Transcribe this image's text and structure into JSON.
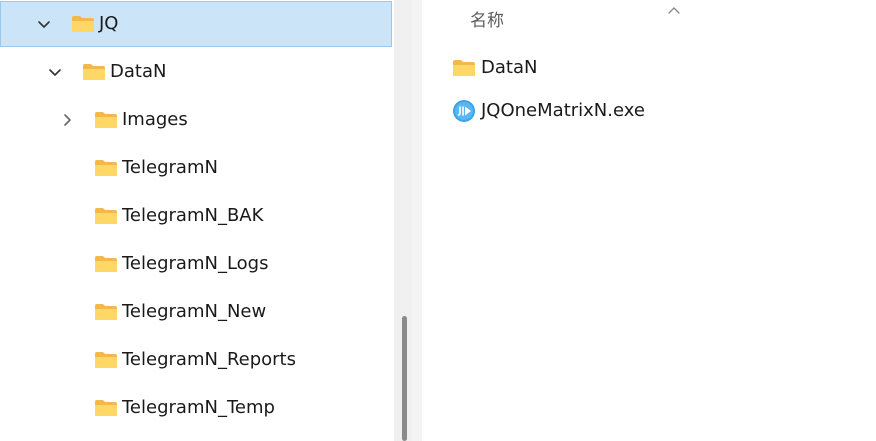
{
  "nav": {
    "items": [
      {
        "label": "JQ",
        "expanded": true,
        "level": 0,
        "selected": true
      },
      {
        "label": "DataN",
        "expanded": true,
        "level": 1
      },
      {
        "label": "Images",
        "expanded": false,
        "has_children": true,
        "level": 2
      },
      {
        "label": "TelegramN",
        "level": 2
      },
      {
        "label": "TelegramN_BAK",
        "level": 2
      },
      {
        "label": "TelegramN_Logs",
        "level": 2
      },
      {
        "label": "TelegramN_New",
        "level": 2
      },
      {
        "label": "TelegramN_Reports",
        "level": 2
      },
      {
        "label": "TelegramN_Temp",
        "level": 2
      }
    ]
  },
  "content": {
    "column_header": "名称",
    "sort_icon": "chevron-up-icon",
    "files": [
      {
        "name": "DataN",
        "type": "folder",
        "icon": "folder-icon"
      },
      {
        "name": "JQOneMatrixN.exe",
        "type": "application",
        "icon": "app-icon"
      }
    ]
  },
  "colors": {
    "selection_bg": "#cce4f7",
    "selection_border": "#99c9ef",
    "folder_yellow": "#ffd766",
    "folder_dark": "#f2b84b",
    "app_icon_blue": "#3ba3e8"
  }
}
